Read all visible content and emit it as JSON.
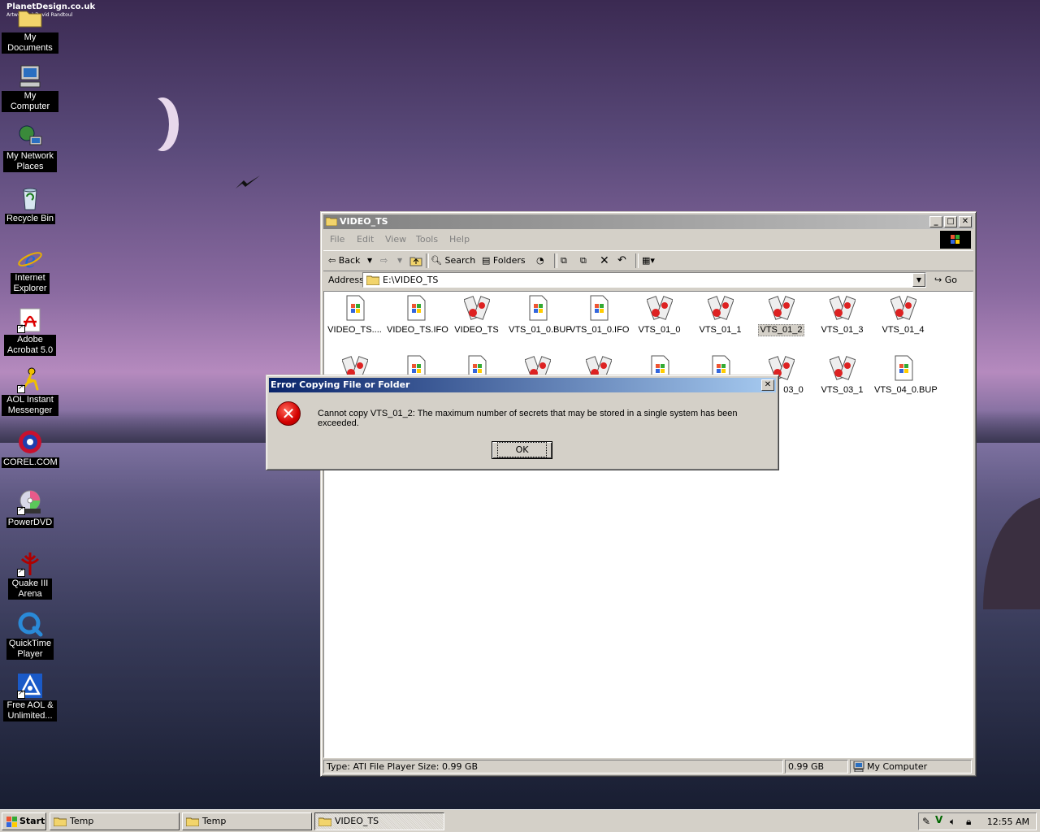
{
  "wallpaper": {
    "credit_line1": "PlanetDesign.co.uk",
    "credit_line2": "Artwork (c) David Randtoul"
  },
  "desktop_icons": [
    {
      "label": "My Documents"
    },
    {
      "label": "My Computer"
    },
    {
      "label": "My Network Places"
    },
    {
      "label": "Recycle Bin"
    },
    {
      "label": "Internet Explorer"
    },
    {
      "label": "Adobe Acrobat 5.0"
    },
    {
      "label": "AOL Instant Messenger"
    },
    {
      "label": "COREL.COM"
    },
    {
      "label": "PowerDVD"
    },
    {
      "label": "Quake III Arena"
    },
    {
      "label": "QuickTime Player"
    },
    {
      "label": "Free AOL & Unlimited..."
    }
  ],
  "explorer": {
    "title": "VIDEO_TS",
    "menu": [
      "File",
      "Edit",
      "View",
      "Tools",
      "Help"
    ],
    "toolbar": {
      "back": "Back",
      "search": "Search",
      "folders": "Folders"
    },
    "address_label": "Address",
    "address_value": "E:\\VIDEO_TS",
    "go_label": "Go",
    "files_row1": [
      "VIDEO_TS....",
      "VIDEO_TS.IFO",
      "VIDEO_TS",
      "VTS_01_0.BUP",
      "VTS_01_0.IFO",
      "VTS_01_0",
      "VTS_01_1",
      "VTS_01_2",
      "VTS_01_3",
      "VTS_01_4"
    ],
    "files_row2_visible": [
      "03_0",
      "VTS_03_1",
      "VTS_04_0.BUP"
    ],
    "status": {
      "type_size": "Type: ATI File Player Size: 0.99 GB",
      "size": "0.99 GB",
      "zone": "My Computer"
    }
  },
  "dialog": {
    "title": "Error Copying File or Folder",
    "message": "Cannot copy VTS_01_2: The maximum number of secrets that may be stored in a single system has been exceeded.",
    "ok_label": "OK",
    "close_glyph": "✕"
  },
  "taskbar": {
    "start_label": "Start",
    "buttons": [
      "Temp",
      "Temp",
      "VIDEO_TS"
    ],
    "clock": "12:55 AM"
  },
  "colors": {
    "active_title": "#0a246a",
    "inactive_title": "#808080",
    "error_red": "#d40000"
  }
}
